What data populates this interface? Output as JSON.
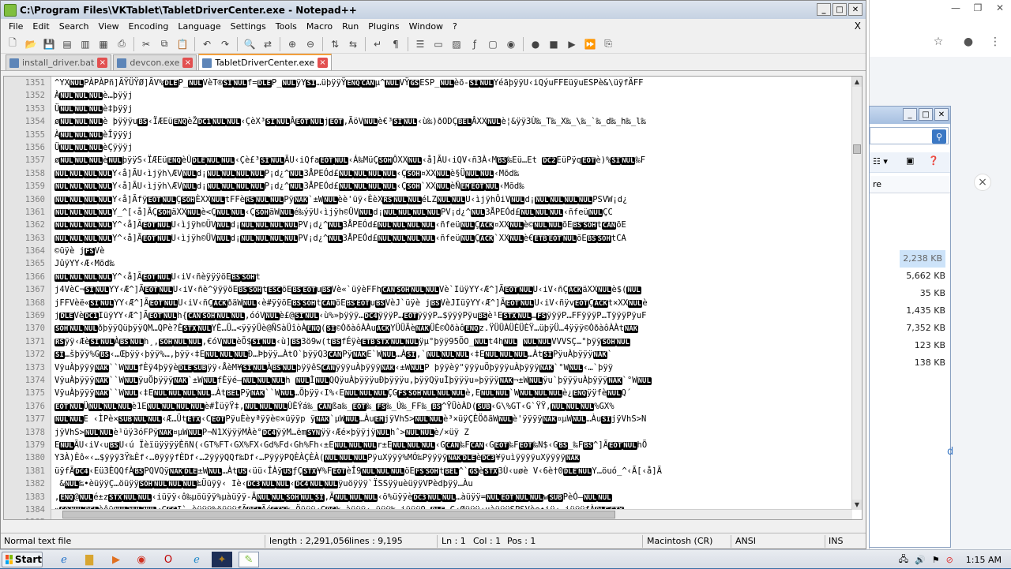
{
  "window": {
    "title": "C:\\Program Files\\VKTablet\\TabletDriverCenter.exe - Notepad++",
    "close_x": "X"
  },
  "menu": [
    "File",
    "Edit",
    "Search",
    "View",
    "Encoding",
    "Language",
    "Settings",
    "Tools",
    "Macro",
    "Run",
    "Plugins",
    "Window",
    "?"
  ],
  "tabs": [
    {
      "label": "install_driver.bat",
      "active": false
    },
    {
      "label": "devcon.exe",
      "active": false
    },
    {
      "label": "TabletDriverCenter.exe",
      "active": true
    }
  ],
  "editor": {
    "lines": [
      {
        "n": "1351",
        "t": "^YXNULPÀPÀPñ]ÃŸÜŸØ]ÃV%DLEP_NULVèT®SINULf=DLEP_NULÿYSI…üþÿÿŸENQCANµ^NULVŸGSESP_NULèõ-SINULYéãþÿÿU‹iQýuFFEüÿuESPè&\\üÿfÄFF"
      },
      {
        "n": "1352",
        "t": "ÀNULNULNULè…þÿÿj"
      },
      {
        "n": "1353",
        "t": "ÜNULNULNULè‡þÿÿj"
      },
      {
        "n": "1354",
        "t": "øNULNULNULè þÿÿÿuBS‹ÏÆEüENQèŽDC1NULNUL‹ÇèX³SINULÂEOTNULjEOT,ÃöVNULè€³SINUL‹ù‰)ðODÇBELÂXXNULè¦&ÿÿ3Ù‰_T‰_X‰_\\‰_`‰_d‰_h‰_l‰"
      },
      {
        "n": "1355",
        "t": "ÀNULNULNULèÎÿÿÿj"
      },
      {
        "n": "1356",
        "t": "ÜNULNULNULèÇÿÿÿj"
      },
      {
        "n": "1357",
        "t": "øNULNULNULèNULþÿÿS‹ÏÆEüENQèÙDLENULNUL‹Çè£³SINULÃU‹iQfaEOTNUL‹Á‰MüÇSOHÔXXNUL‹å]ÃU‹iQV‹ñ3À‹MBS‰Eü…Et DC2EüPÿqEOTè)%SINUL‰F"
      },
      {
        "n": "1358",
        "t": "NULNULNULNULY‹å]ÃU‹ìjÿh\\ÆVNULd¡NULNULNULNULP¡d¿^NUL3ÅPEÓd£NULNULNULNUL‹ÇSOH¤XXNULè§ÜNULNUL‹Mõd‰"
      },
      {
        "n": "1359",
        "t": "NULNULNULNULY‹å]ÃU‹ìjÿh\\ÆVNULd¡NULNULNULNULP¡d¿^NUL3ÅPEÓd£NULNULNULNUL‹ÇSOH`XXNULèÑEMEOTNUL‹Mõd‰"
      },
      {
        "n": "1360",
        "t": "NULNULNULNULY‹å]ÃfÿEOTNULÇSOHÈXXNULtFFèRSNULNULPÿNAK`±WNULèè'üÿ‹ÈèXRSNULNULéLZNULNULU‹ìjÿhÔiVNULd¡NULNULNULNULPSVW¡d¿"
      },
      {
        "n": "1361",
        "t": "NULNULNULNULY_^[‹å]ÃÇSOHäXXNULè<ÇNULNUL‹ÇSOHäWNULé‰ýÿU‹ìjÿh©ÜVNULd¡NULNULNULNULPV¡d¿^NUL3ÅPEÓd£NULNULNUL‹ñfeüNULÇC"
      },
      {
        "n": "1362",
        "t": "NULNULNULNULY^‹å]ÃEOTNULU‹ìjÿh©ÜVNULd¡NULNULNULNULPV¡d¿^NUL3ÅPEÓd£NULNULNULNUL‹ñfeüNULÇACK¤XXNULè©NULNULõEBSSOHtCANõE"
      },
      {
        "n": "1363",
        "t": "NULNULNULNULY^‹å]ÃEOTNULU‹ìjÿh©ÜVNULd¡NULNULNULNULPV¡d¿^NUL3ÅPEÓd£NULNULNULNUL‹ñfeüNULÇACK`XXNULè€ETBEOTNULõEBSSOHtCA"
      },
      {
        "n": "1364",
        "t": "©üÿè    jFSVè"
      },
      {
        "n": "1365",
        "t": "JûÿYY‹Æ‹Mõd‰"
      },
      {
        "n": "1366",
        "t": "NULNULNULNULY^‹å]ÃEOTNULU‹iV‹ñèÿÿÿöEBSSOHt"
      },
      {
        "n": "1367",
        "t": "j4VèC¬SINULYY‹Æ^]ÃEOTNULU‹iV‹ñè^ÿÿÿöEBSSOHtESCöEBSEOTuBSVè«`üÿèFFhCANSOHNULNULVè`IüÿYY‹Æ^]ÃEOTNULU‹iV‹ñÇACKäXXNULè$(NUL"
      },
      {
        "n": "1368",
        "t": "jFFVèë«SINULYY‹Æ^]ÃEOTNULU‹iV‹ñÇACKðäWNUL‹è#ÿÿöEBSSOHtCANöEBSEOTuBSVèJ`üÿè jBSVèJIüÿYY‹Æ^]ÃEOTNULU‹iV‹ñÿvEOTÇACKt×XXNULè"
      },
      {
        "n": "1369",
        "t": "jDLEVèDC1IüÿYY‹Æ^]ÃEOTNULh{CANSOHNULNUL,óóVNULè£@SINUL‹ù%»þÿÿÿ…DC4ÿÿÿP…EOTÿÿÿP…$ÿÿÿPÿuBSè¹ESTXNUL…FSÿÿÿP…FFÿÿÿP…TÿÿÿPÿuF"
      },
      {
        "n": "1370",
        "t": "SOHNULNULðþÿÿQüþÿÿQM…QPè?ÈSTXNULYÈ…Ü…<ÿÿÿÜè@ÑSàÜîòÀENQ(SI©ÒðàôÀÀuACKYÜÜÃèNAKÜÈ©ÒðàôENQz.ŸÜÜÀÜÈÜÈŸ…üþÿÜ…4ÿÿÿ©ÒðàôÀÀtNAK"
      },
      {
        "n": "1371",
        "t": "RSÿÿ‹ÆèSINULÀBSNULh¸,SOHNULNUL,€óVNULèÕ$SINUL‹ù]BS3ö9w(tBSfÉÿèETBSTXNULNULÿµ°þÿÿ95ÕO_NULt4hNUL NULNULVVVSÇ…°þÿÿSOHNUL"
      },
      {
        "n": "1372",
        "t": "SI…šþÿÿ%GBS‹…Œþÿÿ‹þÿÿ%…,þÿÿ‹‡ENULNULNULÐ…Þþÿÿ…ÀtO`þÿÿQ3CANPÿNAKE`WNUL…ÀSI,`NULNULNUL‹‡ENULNULNUL…ÀtSIPÿuÀþÿÿÿNAK`"
      },
      {
        "n": "1373",
        "t": "VÿuÀþÿÿÿNAK``WNULfÈÿ4þÿÿèDLESUBÿÿ‹ÅèM¥SINULÀBSNULþÿÿêSCANÿÿÿuÀþÿÿÿNAK‹±WNULP þÿÿèÿ\"ÿÿÿuÖþÿÿÿuÀþÿÿÿNAK`°WNUL‹…`þÿÿ"
      },
      {
        "n": "1374",
        "t": "VÿuÀþÿÿÿNAK``WNULÿuÖþÿÿÿNAK`±WNULfÈÿé—NULNULNULh NULÌNULQQÿuÀþÿÿÿuÐþÿÿÿu,þÿÿQÿuÌþÿÿÿu»þÿÿÿNAK¬±WNULÿu`þÿÿÿuÀþÿÿÿNAK`°WNUL"
      },
      {
        "n": "1375",
        "t": "VÿuÀþÿÿÿNAK``WNUL‹‡ENULNULNULNUL…ÀtBELPÿNAK``WNUL…Öþÿÿ‹I%‹ENULNULNULÇGFSSOHNULNULNULè,ENULNUL`WNULNULNULè¿ENQÿÿfèNULQ´"
      },
      {
        "n": "1376",
        "t": "EOTNULÜNULNULNULè1ENULNULNULNULè#ÌüÿŸ‡,NULNULNULÙÈÝá‰_CANßa‰_EOT‰_FS‰_Ú‰_FF‰_BS^ŸÜòÀD(SUB‹G\\%GT‹G`ŸŸ,NULNULNUL%GX%"
      },
      {
        "n": "1377",
        "t": "NULNULE ‹ÌPè×SUBNULNUL‹Æ…ÜtETX‹CEOTPÿuÈèyªÿÿè©×üÿÿp ÿNAK`µWNUL…ÀuEMjÿVhS>NULNULè³×üÿÇÈÖðãWNULè'ÿÿÿÿNAK¤µWNUL…ÀuSIjÿVhS>N"
      },
      {
        "n": "1378",
        "t": "jÿVhS>NULNULè¹üÿ3óFPÿNAK¤µWNULP¬N1XÿÿÿMÀè°DC4ÿÿM…ëmSYNÿÿ‹Æé×þÿÿjÿNULhˆ>NULNULè/×üÿ Z"
      },
      {
        "n": "1379",
        "t": "ENULÃU‹iV‹uBSU‹ú ÏèïüÿÿÿÿÈñN(‹GT%FT‹GX%FX‹Gd%Fd‹Gh%Fh‹±ENULNULNULr±ENULNULNUL‹GCAN‰FCAN‹GEOT‰FEOT‰N$‹GBS_‰FBS^]ÃEOTNULhÕ"
      },
      {
        "n": "1380",
        "t": "Y3À)Èô«‹…$ÿÿÿ3Ÿ‰Èf‹…0ÿÿÿfÈDf‹…2ÿÿÿQQf‰Df‹…PÿÿÿPQÈÀÇÈÀ(NULNULNULPÿuXÿÿÿ%MÓ‰PÿÿÿÿNAKDLEèDC3¥ÿuìÿÿÿÿuXÿÿÿÿNAK"
      },
      {
        "n": "1381",
        "t": "üÿfÃDC4‹Eü3ÈQQfÀBSPQVQÿNAKDLE±WNUL…ÀtUS‹üü‹ÎÀÿUSƒÇSTX¥%FEOTèÎ9NULNULNULöEFSSOHtBEL^`GSèSTX3Ù‹uøè V‹6è†0DLENULY…öuó_^‹Ã[‹å]Ã"
      },
      {
        "n": "1382",
        "t": " &NUL‰•èüÿÿÇ…öüÿÿSOHNULNULNUL‰Üüÿÿ‹ Iè‹DC3NULNUL‹DC4NULNULÿuöÿÿÿ`ÏSSÿÿuèüÿÿVPèdþÿÿ…Àu"
      },
      {
        "n": "1383",
        "t": "‚ENQ@NULé±zSTXNULNUL‹iüÿÿ‹ô‰µöüÿÿ%µàüÿÿ-ÃNULNULSOHNULSI,ÃNULNULNUL‹ö%üÿÿèDC3NULNUL…àüÿÿ=NULEOTNULNULwSUBPèÓ—NULNUL"
      },
      {
        "n": "1384",
        "t": "»SONULBELèêüNULNULNUL‹GFSI`…èüÿÿ%öüÿÿfÃBELÃéETX‰…Öüÿÿ‹GBS‰…àüÿÿ‹…üÿÿ‰…iüÿÿ9_DLE-G‹Øüÿÿ‹µàüÿÿSPSVèe•iÿ‹…iüÿÿfÀDLEETX"
      },
      {
        "n": "1385",
        "t": "ÐO_NUL‹FXhENUL`NULWWQ®P‹FT®PjSOHjSOHQÿNAK¬±WNUL^]ÃFFNULjD_;öVNULèŽ`SINUL‹uBS…öuBEL3ÀéSYNSOHNULNULÈ°Pj CANVÿNAKE`WNUL"
      }
    ]
  },
  "status": {
    "filetype": "Normal text file",
    "length": "length : 2,291,056",
    "lines": "lines : 9,195",
    "ln": "Ln : 1",
    "col": "Col : 1",
    "pos": "Pos : 1",
    "eol": "Macintosh (CR)",
    "encoding": "ANSI",
    "mode": "INS"
  },
  "explorer": {
    "column_header": "re",
    "sizes": [
      "2,238 KB",
      "5,662 KB",
      "35 KB",
      "1,435 KB",
      "7,352 KB",
      "123 KB",
      "138 KB"
    ],
    "link_fragment": "d"
  },
  "taskbar": {
    "start": "Start",
    "clock": "1:15 AM"
  }
}
